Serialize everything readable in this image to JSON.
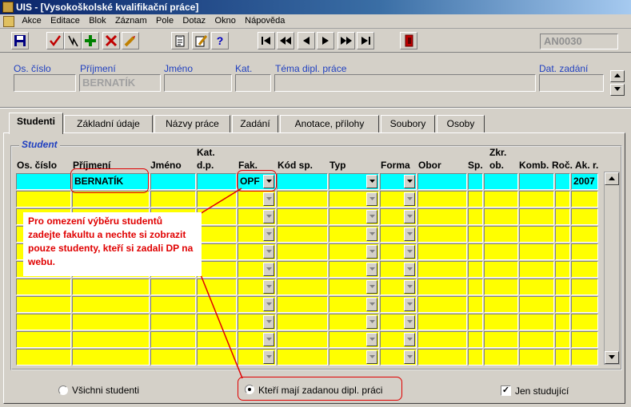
{
  "window": {
    "title": "UIS - [Vysokoškolské kvalifikační práce]"
  },
  "menu": [
    "Akce",
    "Editace",
    "Blok",
    "Záznam",
    "Pole",
    "Dotaz",
    "Okno",
    "Nápověda"
  ],
  "toolbar": {
    "form_code": "AN0030",
    "help_label": "?",
    "buttons": [
      "save-icon",
      "accept-icon",
      "separator-icon",
      "add-record-icon",
      "delete-record-icon",
      "edit-icon",
      "clipboard-icon",
      "pencil-icon",
      "help-icon",
      "first-record-icon",
      "prev-page-icon",
      "prev-record-icon",
      "next-record-icon",
      "next-page-icon",
      "last-record-icon",
      "exit-icon"
    ]
  },
  "header": {
    "labels": {
      "os_cislo": "Os. číslo",
      "prijmeni": "Příjmení",
      "jmeno": "Jméno",
      "kat": "Kat.",
      "tema": "Téma dipl. práce",
      "dat_zadani": "Dat. zadání"
    },
    "values": {
      "os_cislo": "",
      "prijmeni": "BERNATÍK",
      "jmeno": "",
      "kat": "",
      "tema": "",
      "dat_zadani": ""
    }
  },
  "tabs": [
    "Studenti",
    "Základní údaje",
    "Názvy práce",
    "Zadání",
    "Anotace, přílohy",
    "Soubory",
    "Osoby"
  ],
  "active_tab": "Studenti",
  "group_title": "Student",
  "columns": {
    "os_cislo": "Os. číslo",
    "prijmeni": "Příjmení",
    "jmeno": "Jméno",
    "kat_dp_1": "Kat.",
    "kat_dp_2": "d.p.",
    "fak": "Fak.",
    "kod_sp": "Kód sp.",
    "typ": "Typ",
    "forma": "Forma",
    "obor": "Obor",
    "sp": "Sp.",
    "zkr_ob_1": "Zkr.",
    "zkr_ob_2": "ob.",
    "komb": "Komb.",
    "roc": "Roč.",
    "ak_r": "Ak. r."
  },
  "first_row": {
    "prijmeni": "BERNATÍK",
    "fak": "OPF",
    "ak_r": "2007"
  },
  "row_count": 11,
  "callout": "Pro omezení výběru studentů zadejte fakultu a nechte si zobrazit pouze studenty, kteří si zadali DP na webu.",
  "filters": {
    "all_students": "Všichni studenti",
    "with_thesis": "Kteří mají zadanou dipl. práci",
    "selected": "with_thesis",
    "only_studying": "Jen studující",
    "only_studying_checked": true,
    "check_mark": "✓"
  },
  "colors": {
    "grid_active_row": "#00ffff",
    "grid_rows": "#ffff00",
    "highlight": "#e00000",
    "label_blue": "#2040c0"
  }
}
